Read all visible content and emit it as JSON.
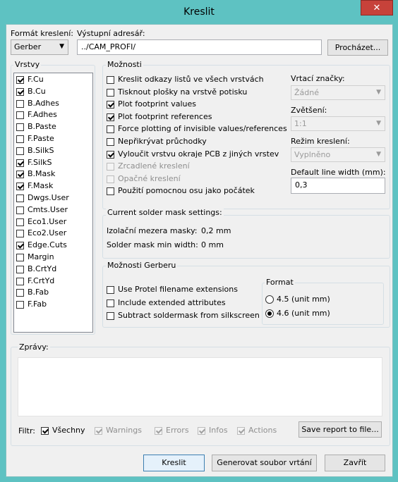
{
  "window": {
    "title": "Kreslit",
    "close_glyph": "✕"
  },
  "format": {
    "label": "Formát kreslení:",
    "value": "Gerber"
  },
  "output": {
    "label": "Výstupní adresář:",
    "value": "../CAM_PROFI/",
    "browse": "Procházet..."
  },
  "layers": {
    "title": "Vrstvy",
    "items": [
      {
        "label": "F.Cu",
        "checked": true
      },
      {
        "label": "B.Cu",
        "checked": true
      },
      {
        "label": "B.Adhes",
        "checked": false
      },
      {
        "label": "F.Adhes",
        "checked": false
      },
      {
        "label": "B.Paste",
        "checked": false
      },
      {
        "label": "F.Paste",
        "checked": false
      },
      {
        "label": "B.SilkS",
        "checked": false
      },
      {
        "label": "F.SilkS",
        "checked": true
      },
      {
        "label": "B.Mask",
        "checked": true
      },
      {
        "label": "F.Mask",
        "checked": true
      },
      {
        "label": "Dwgs.User",
        "checked": false
      },
      {
        "label": "Cmts.User",
        "checked": false
      },
      {
        "label": "Eco1.User",
        "checked": false
      },
      {
        "label": "Eco2.User",
        "checked": false
      },
      {
        "label": "Edge.Cuts",
        "checked": true
      },
      {
        "label": "Margin",
        "checked": false
      },
      {
        "label": "B.CrtYd",
        "checked": false
      },
      {
        "label": "F.CrtYd",
        "checked": false
      },
      {
        "label": "B.Fab",
        "checked": false
      },
      {
        "label": "F.Fab",
        "checked": false
      }
    ]
  },
  "options": {
    "title": "Možnosti",
    "items": [
      {
        "label": "Kreslit odkazy listů ve všech vrstvách",
        "checked": false,
        "enabled": true
      },
      {
        "label": "Tisknout plošky na vrstvě potisku",
        "checked": false,
        "enabled": true
      },
      {
        "label": "Plot footprint values",
        "checked": true,
        "enabled": true
      },
      {
        "label": "Plot footprint references",
        "checked": true,
        "enabled": true
      },
      {
        "label": "Force plotting of invisible values/references",
        "checked": false,
        "enabled": true
      },
      {
        "label": "Nepřikrývat průchodky",
        "checked": false,
        "enabled": true
      },
      {
        "label": "Vyloučit vrstvu okraje PCB z jiných vrstev",
        "checked": true,
        "enabled": true
      },
      {
        "label": "Zrcadlené kreslení",
        "checked": false,
        "enabled": false
      },
      {
        "label": "Opačné kreslení",
        "checked": false,
        "enabled": false
      },
      {
        "label": "Použití pomocnou osu jako počátek",
        "checked": false,
        "enabled": true
      }
    ],
    "drill_marks": {
      "label": "Vrtací značky:",
      "value": "Žádné"
    },
    "scale": {
      "label": "Zvětšení:",
      "value": "1:1"
    },
    "plot_mode": {
      "label": "Režim kreslení:",
      "value": "Vyplněno"
    },
    "line_width": {
      "label": "Default line width (mm):",
      "value": "0,3"
    }
  },
  "solder_mask": {
    "title": "Current solder mask settings:",
    "clearance_label": "Izolační mezera masky:",
    "clearance_value": "0,2 mm",
    "min_width_label": "Solder mask min width:",
    "min_width_value": "0 mm"
  },
  "gerber": {
    "title": "Možnosti Gerberu",
    "items": [
      {
        "label": "Use Protel filename extensions",
        "checked": false
      },
      {
        "label": "Include extended attributes",
        "checked": false
      },
      {
        "label": "Subtract soldermask from silkscreen",
        "checked": false
      }
    ],
    "format_title": "Format",
    "formats": [
      {
        "label": "4.5 (unit mm)",
        "selected": false
      },
      {
        "label": "4.6 (unit mm)",
        "selected": true
      }
    ]
  },
  "messages": {
    "title": "Zprávy:",
    "filter_label": "Filtr:",
    "filters": [
      {
        "label": "Všechny",
        "checked": true,
        "enabled": true
      },
      {
        "label": "Warnings",
        "checked": true,
        "enabled": false
      },
      {
        "label": "Errors",
        "checked": true,
        "enabled": false
      },
      {
        "label": "Infos",
        "checked": true,
        "enabled": false
      },
      {
        "label": "Actions",
        "checked": true,
        "enabled": false
      }
    ],
    "save_report": "Save report to file..."
  },
  "buttons": {
    "plot": "Kreslit",
    "drill": "Generovat soubor vrtání",
    "close": "Zavřít"
  }
}
